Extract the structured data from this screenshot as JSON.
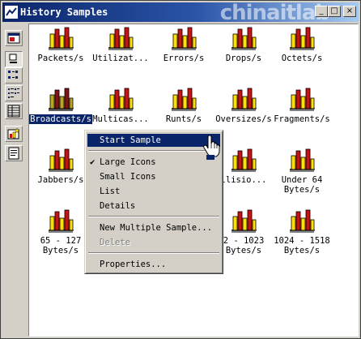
{
  "window": {
    "title": "History Samples",
    "watermark": "chinaitlab"
  },
  "caption_buttons": {
    "minimize": "_",
    "maximize": "□",
    "close": "×"
  },
  "toolbar": [
    "view-icon",
    "large-icons-icon",
    "small-icons-icon",
    "list-icon",
    "details-icon",
    "new-sample-icon",
    "properties-icon"
  ],
  "items": [
    {
      "label": "Packets/s"
    },
    {
      "label": "Utilizat..."
    },
    {
      "label": "Errors/s"
    },
    {
      "label": "Drops/s"
    },
    {
      "label": "Octets/s"
    },
    {
      "label": "Broadcasts/s",
      "selected": true
    },
    {
      "label": "Multicas..."
    },
    {
      "label": "Runts/s"
    },
    {
      "label": "Oversizes/s"
    },
    {
      "label": "Fragments/s"
    },
    {
      "label": "Jabbers/s"
    },
    {
      "label": ""
    },
    {
      "label": ""
    },
    {
      "label": "llisio..."
    },
    {
      "label": "Under 64 Bytes/s"
    },
    {
      "label": "65 - 127 Bytes/s"
    },
    {
      "label": ""
    },
    {
      "label": ""
    },
    {
      "label": "2 - 1023 Bytes/s"
    },
    {
      "label": "1024 - 1518 Bytes/s"
    }
  ],
  "context_menu": {
    "start_sample": "Start Sample",
    "large_icons": "Large Icons",
    "small_icons": "Small Icons",
    "list": "List",
    "details": "Details",
    "new_multiple_sample": "New Multiple Sample...",
    "delete": "Delete",
    "properties": "Properties..."
  },
  "colors": {
    "titlebar": "#0a246a",
    "selection": "#0a246a",
    "bar_red": "#cc1111",
    "bar_yellow": "#ffe000"
  }
}
